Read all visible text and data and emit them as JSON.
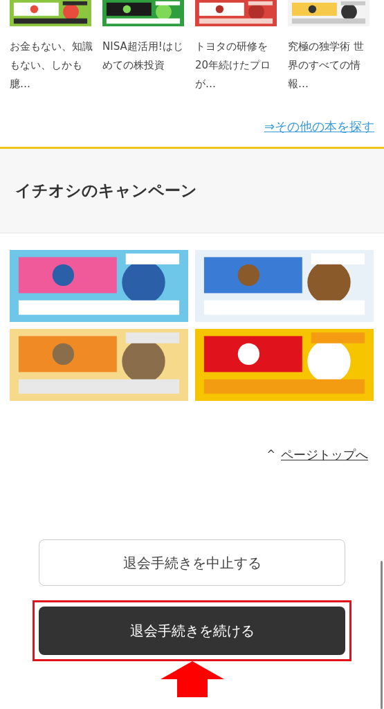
{
  "books": [
    {
      "title": "お金もない、知識もない、しかも臆…"
    },
    {
      "title": "NISA超活用!はじめての株投資"
    },
    {
      "title": "トヨタの研修を20年続けたプロが…"
    },
    {
      "title": "究極の独学術 世界のすべての情報…"
    }
  ],
  "more_books_link": "⇒その他の本を探す",
  "campaign_section": {
    "heading": "イチオシのキャンペーン"
  },
  "page_top_link": {
    "icon": "^",
    "label": "ページトップへ"
  },
  "buttons": [
    {
      "label": "退会手続きを中止する",
      "kind": "outline",
      "highlighted": false
    },
    {
      "label": "退会手続きを続ける",
      "kind": "dark",
      "highlighted": true
    }
  ]
}
